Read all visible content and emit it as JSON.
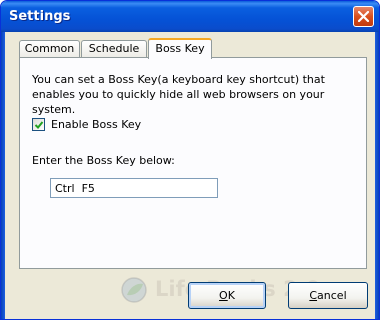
{
  "window": {
    "title": "Settings"
  },
  "tabs": [
    {
      "label": "Common",
      "active": false
    },
    {
      "label": "Schedule",
      "active": false
    },
    {
      "label": "Boss Key",
      "active": true
    }
  ],
  "boss_key": {
    "description": "You can set a Boss Key(a keyboard key shortcut) that enables you to quickly hide all web browsers on your system.",
    "enable_label": "Enable Boss Key",
    "enable_checked": true,
    "field_label": "Enter the Boss Key below:",
    "key_value": "Ctrl  F5"
  },
  "buttons": {
    "ok_label_underlined": "O",
    "ok_label_rest": "K",
    "cancel_label_underlined": "C",
    "cancel_label_rest": "ancel"
  },
  "watermark": {
    "text": "Life Rocks 2.0"
  },
  "icons": {
    "close": "close-icon",
    "checkmark": "checkmark-icon",
    "watermark": "globe-leaf-icon"
  },
  "colors": {
    "titlebar": "#0552d6",
    "window_bg": "#ece9d8",
    "active_tab_accent": "#f5a823",
    "close_button": "#d9501d"
  }
}
